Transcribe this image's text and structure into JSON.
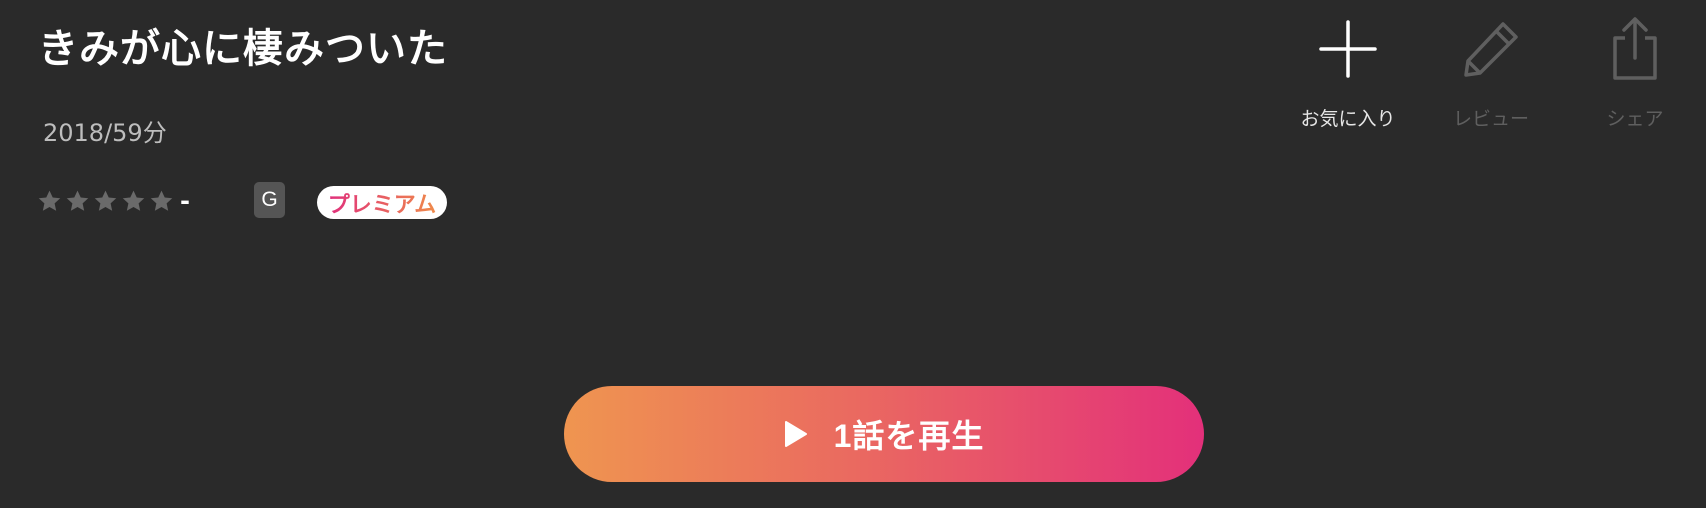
{
  "title": "きみが心に棲みついた",
  "meta": "2018/59分",
  "rating": {
    "stars_filled": 0,
    "stars_total": 5,
    "value_text": "-",
    "star_color": "#6a6a6a"
  },
  "age_badge": "G",
  "premium_badge": "プレミアム",
  "actions": {
    "favorite": {
      "label": "お気に入り",
      "icon": "plus-icon",
      "enabled": true
    },
    "review": {
      "label": "レビュー",
      "icon": "pencil-icon",
      "enabled": false
    },
    "share": {
      "label": "シェア",
      "icon": "share-icon",
      "enabled": false
    }
  },
  "play_button": {
    "label": "1話を再生",
    "icon": "play-icon",
    "gradient_start": "#ef9550",
    "gradient_end": "#e3307a"
  },
  "colors": {
    "background": "#2a2a2a",
    "accent_pink": "#e3307a",
    "accent_orange": "#ef9550"
  }
}
